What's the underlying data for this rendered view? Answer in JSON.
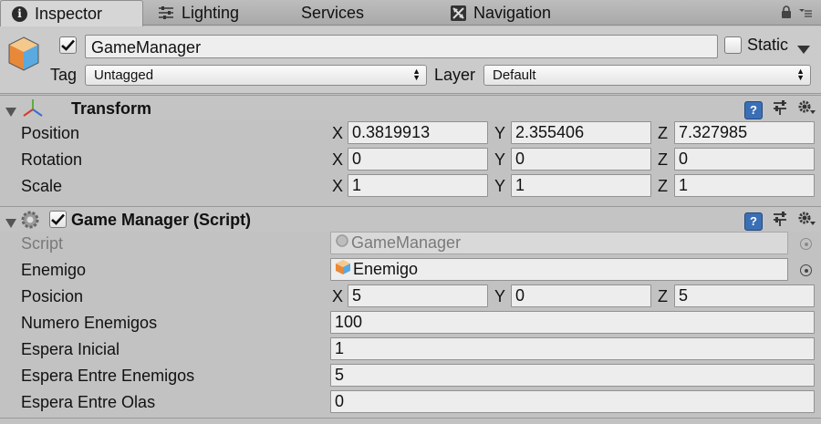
{
  "tabs": [
    {
      "label": "Inspector",
      "icon": "info-icon",
      "active": true
    },
    {
      "label": "Lighting",
      "icon": "sliders-icon",
      "active": false
    },
    {
      "label": "Services",
      "icon": "",
      "active": false
    },
    {
      "label": "Navigation",
      "icon": "navigation-icon",
      "active": false
    }
  ],
  "header": {
    "object_name": "GameManager",
    "static_label": "Static",
    "tag_label": "Tag",
    "tag_value": "Untagged",
    "layer_label": "Layer",
    "layer_value": "Default"
  },
  "transform": {
    "title": "Transform",
    "rows": [
      {
        "label": "Position",
        "x": "0.3819913",
        "y": "2.355406",
        "z": "7.327985"
      },
      {
        "label": "Rotation",
        "x": "0",
        "y": "0",
        "z": "0"
      },
      {
        "label": "Scale",
        "x": "1",
        "y": "1",
        "z": "1"
      }
    ]
  },
  "game_manager": {
    "title": "Game Manager (Script)",
    "script_label": "Script",
    "script_value": "GameManager",
    "enemigo_label": "Enemigo",
    "enemigo_value": "Enemigo",
    "posicion_label": "Posicion",
    "posicion": {
      "x": "5",
      "y": "0",
      "z": "5"
    },
    "fields": [
      {
        "label": "Numero Enemigos",
        "value": "100"
      },
      {
        "label": "Espera Inicial",
        "value": "1"
      },
      {
        "label": "Espera Entre Enemigos",
        "value": "5"
      },
      {
        "label": "Espera Entre Olas",
        "value": "0"
      }
    ]
  },
  "axes": {
    "x": "X",
    "y": "Y",
    "z": "Z"
  },
  "colors": {
    "help_icon": "#3b6fb5",
    "background": "#c2c2c2"
  }
}
